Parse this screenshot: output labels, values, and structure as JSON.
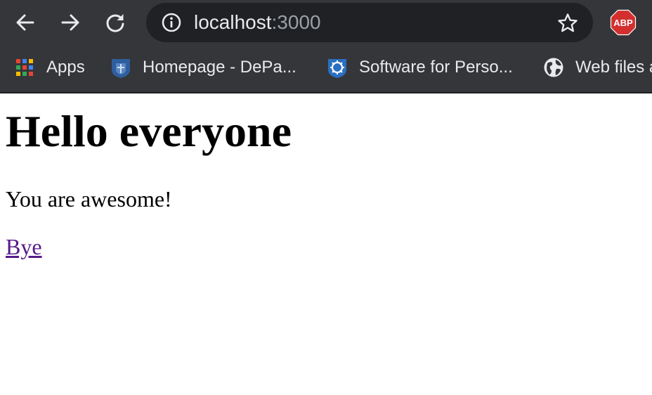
{
  "browser": {
    "nav": {
      "back_icon": "arrow-left-icon",
      "forward_icon": "arrow-right-icon",
      "reload_icon": "reload-icon"
    },
    "omnibox": {
      "info_icon": "info-icon",
      "url_host": "localhost",
      "url_port": ":3000",
      "bookmark_icon": "star-icon"
    },
    "extensions": {
      "adblock_label": "ABP",
      "adblock_color": "#d32f2f"
    },
    "bookmarks": [
      {
        "label": "Apps",
        "icon": "apps-grid-icon"
      },
      {
        "label": "Homepage - DePa...",
        "icon": "site-shield-icon"
      },
      {
        "label": "Software for Perso...",
        "icon": "site-gear-icon"
      },
      {
        "label": "Web files a",
        "icon": "globe-icon"
      }
    ],
    "colors": {
      "frame": "#35363a",
      "omnibox": "#202124",
      "text": "#e8eaed",
      "muted": "#9aa0a6"
    }
  },
  "page": {
    "heading": "Hello everyone",
    "paragraph": "You are awesome!",
    "link_text": "Bye",
    "link_color": "#551a8b"
  }
}
